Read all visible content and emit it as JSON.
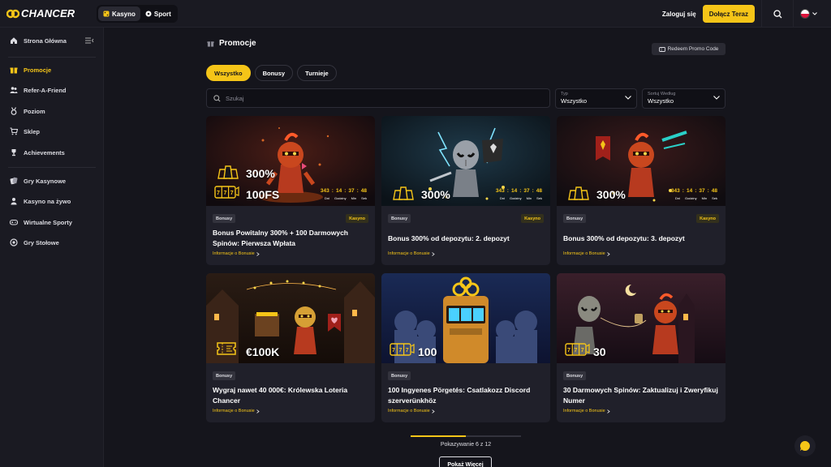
{
  "brand": {
    "name": "CHANCER"
  },
  "header": {
    "modes": [
      {
        "label": "Kasyno",
        "active": true
      },
      {
        "label": "Sport",
        "active": false
      }
    ],
    "login_label": "Zaloguj się",
    "join_label": "Dołącz Teraz",
    "search_icon": "search-icon",
    "language_flag": "poland-flag"
  },
  "sidebar": {
    "items": [
      {
        "label": "Strona Główna",
        "icon": "home-icon"
      },
      {
        "label": "Promocje",
        "icon": "gift-icon",
        "active": true
      },
      {
        "label": "Refer-A-Friend",
        "icon": "users-icon"
      },
      {
        "label": "Poziom",
        "icon": "medal-icon"
      },
      {
        "label": "Sklep",
        "icon": "cart-icon"
      },
      {
        "label": "Achievements",
        "icon": "trophy-icon"
      },
      {
        "label": "Gry Kasynowe",
        "icon": "cards-icon"
      },
      {
        "label": "Kasyno na żywo",
        "icon": "dealer-icon"
      },
      {
        "label": "Wirtualne Sporty",
        "icon": "gamepad-icon"
      },
      {
        "label": "Gry Stołowe",
        "icon": "chips-icon"
      }
    ]
  },
  "main": {
    "title": "Promocje",
    "redeem_label": "Redeem Promo Code",
    "tabs": [
      {
        "label": "Wszystko",
        "active": true
      },
      {
        "label": "Bonusy"
      },
      {
        "label": "Turnieje"
      }
    ],
    "search": {
      "placeholder": "Szukaj"
    },
    "filter_type": {
      "label": "Typ",
      "value": "Wszystko"
    },
    "filter_sort": {
      "label": "Sortuj Według",
      "value": "Wszystko"
    }
  },
  "promotions": [
    {
      "tag": "Bonusy",
      "category": "Kasyno",
      "title": "Bonus Powitalny 300% + 100 Darmowych Spinów: Pierwsza Wpłata",
      "link": "Informacje o Bonusie",
      "value1": "300%",
      "value2": "100FS",
      "timer": {
        "days": "343",
        "hours": "14",
        "minutes": "37",
        "seconds": "48"
      }
    },
    {
      "tag": "Bonusy",
      "category": "Kasyno",
      "title": "Bonus 300% od depozytu: 2. depozyt",
      "link": "Informacje o Bonusie",
      "value1": "300%",
      "timer": {
        "days": "343",
        "hours": "14",
        "minutes": "37",
        "seconds": "48"
      }
    },
    {
      "tag": "Bonusy",
      "category": "Kasyno",
      "title": "Bonus 300% od depozytu: 3. depozyt",
      "link": "Informacje o Bonusie",
      "value1": "300%",
      "timer": {
        "days": "343",
        "hours": "14",
        "minutes": "37",
        "seconds": "48"
      }
    },
    {
      "tag": "Bonusy",
      "title": "Wygraj nawet 40 000€: Królewska Loteria Chancer",
      "link": "Informacje o Bonusie",
      "value1": "€100K"
    },
    {
      "tag": "Bonusy",
      "title": "100 Ingyenes Pörgetés: Csatlakozz Discord szerverünkhöz",
      "link": "Informacje o Bonusie",
      "value1": "100"
    },
    {
      "tag": "Bonusy",
      "title": "30 Darmowych Spinów: Zaktualizuj i Zweryfikuj Numer",
      "link": "Informacje o Bonusie",
      "value1": "30"
    }
  ],
  "timer_labels": {
    "days": "Dni",
    "hours": "Godziny",
    "minutes": "Min",
    "seconds": "Sek"
  },
  "pagination": {
    "progress": 0.5,
    "showing": "Pokazywanie 6 z 12",
    "load_more": "Pokaż Więcej"
  },
  "colors": {
    "accent": "#f5c518",
    "background": "#15151c",
    "card": "#20202a"
  }
}
